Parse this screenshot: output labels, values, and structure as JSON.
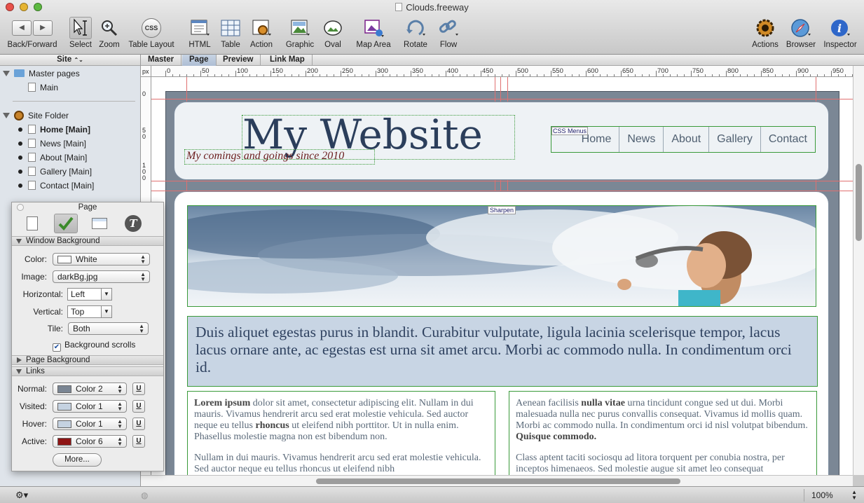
{
  "window": {
    "title": "Clouds.freeway"
  },
  "toolbar": {
    "items": [
      {
        "label": "Back/Forward"
      },
      {
        "label": "Select"
      },
      {
        "label": "Zoom"
      },
      {
        "label": "Table Layout"
      },
      {
        "label": "HTML"
      },
      {
        "label": "Table"
      },
      {
        "label": "Action"
      },
      {
        "label": "Graphic"
      },
      {
        "label": "Oval"
      },
      {
        "label": "Map Area"
      },
      {
        "label": "Rotate"
      },
      {
        "label": "Flow"
      },
      {
        "label": "Actions"
      },
      {
        "label": "Browser"
      },
      {
        "label": "Inspector"
      }
    ],
    "css_glyph": "CSS"
  },
  "sidebar": {
    "title": "Site",
    "title_arrows": "⌃⌄",
    "master_pages": "Master pages",
    "main": "Main",
    "site_folder": "Site Folder",
    "pages": [
      "Home [Main]",
      "News [Main]",
      "About [Main]",
      "Gallery [Main]",
      "Contact [Main]"
    ]
  },
  "inspector": {
    "title": "Page",
    "window_background": "Window Background",
    "color_label": "Color:",
    "color_value": "White",
    "image_label": "Image:",
    "image_value": "darkBg.jpg",
    "horizontal_label": "Horizontal:",
    "horizontal_value": "Left",
    "vertical_label": "Vertical:",
    "vertical_value": "Top",
    "tile_label": "Tile:",
    "tile_value": "Both",
    "bg_scrolls": "Background scrolls",
    "page_background": "Page Background",
    "links": "Links",
    "normal_label": "Normal:",
    "normal_value": "Color  2",
    "visited_label": "Visited:",
    "visited_value": "Color  1",
    "hover_label": "Hover:",
    "hover_value": "Color  1",
    "active_label": "Active:",
    "active_value": "Color  6",
    "u_glyph": "U",
    "more": "More...",
    "swatch_normal": "#7a8593",
    "swatch_visited": "#c5d2e1",
    "swatch_hover": "#c5d2e1",
    "swatch_active": "#8e1414"
  },
  "doc_tabs": [
    "Master",
    "Page",
    "Preview",
    "Link Map"
  ],
  "ruler": {
    "unit": "px",
    "marks": [
      "0",
      "50",
      "100",
      "150",
      "200",
      "250",
      "300",
      "350",
      "400",
      "450",
      "500",
      "550",
      "600",
      "650",
      "700",
      "750",
      "800",
      "850",
      "900",
      "950"
    ],
    "left_marks": [
      "0",
      "5\n0",
      "1\n0\n0"
    ]
  },
  "website": {
    "title": "My Website",
    "tagline": "My comings and goings since 2010",
    "menu_tag": "CSS Menus",
    "menu": [
      "Home",
      "News",
      "About",
      "Gallery",
      "Contact"
    ],
    "sharpen_tag": "Sharpen",
    "intro": "Duis aliquet egestas purus in blandit. Curabitur vulputate, ligula lacinia scelerisque tempor, lacus lacus ornare ante, ac egestas est urna sit amet arcu. Morbi ac commodo nulla. In condimentum orci id.",
    "col1_p1_b1": "Lorem ipsum",
    "col1_p1_t1": " dolor sit amet, consectetur adipiscing elit. Nullam in dui mauris. Vivamus hendrerit arcu sed erat molestie vehicula. Sed auctor neque eu tellus ",
    "col1_p1_b2": "rhoncus",
    "col1_p1_t2": " ut eleifend nibh porttitor. Ut in nulla enim. Phasellus molestie magna non est bibendum non.",
    "col1_p2": "Nullam in dui mauris. Vivamus hendrerit arcu sed erat molestie vehicula. Sed auctor neque eu tellus rhoncus ut eleifend nibh",
    "col2_p1_t1": "Aenean facilisis ",
    "col2_p1_b1": "nulla vitae",
    "col2_p1_t2": " urna tincidunt congue sed ut dui. Morbi malesuada nulla nec purus convallis consequat. Vivamus id mollis quam. Morbi ac commodo nulla. In condimentum orci id nisl volutpat bibendum. ",
    "col2_p1_b2": "Quisque commodo.",
    "col2_p2": "Class aptent taciti sociosqu ad litora torquent per conubia nostra, per inceptos himenaeos. Sed molestie augue sit amet leo consequat"
  },
  "status": {
    "zoom": "100%"
  }
}
